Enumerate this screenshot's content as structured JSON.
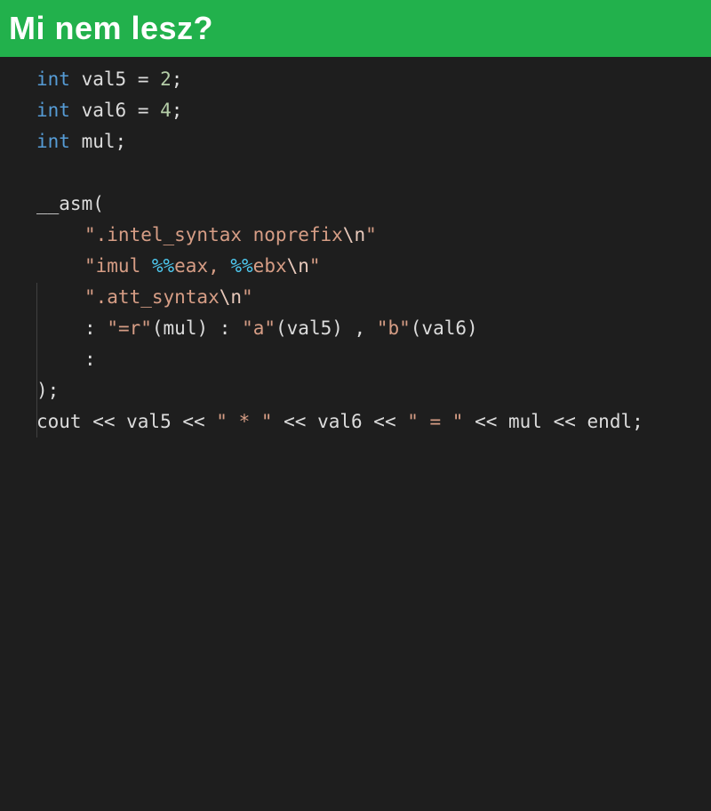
{
  "slide": {
    "title": "Mi nem lesz?"
  },
  "code": {
    "l1": {
      "type": "int",
      "name": "val5",
      "op": "=",
      "value": "2",
      "end": ";"
    },
    "l2": {
      "type": "int",
      "name": "val6",
      "op": "=",
      "value": "4",
      "end": ";"
    },
    "l3": {
      "type": "int",
      "name": "mul",
      "end": ";"
    },
    "l5": {
      "fn": "__asm",
      "paren": "("
    },
    "l6": {
      "q1": "\".intel_syntax noprefix",
      "esc": "\\n",
      "q2": "\""
    },
    "l7": {
      "q1": "\"imul ",
      "p1": "%%",
      "r1": "eax, ",
      "p2": "%%",
      "r2": "ebx",
      "esc": "\\n",
      "q2": "\""
    },
    "l8": {
      "q1": "\".att_syntax",
      "esc": "\\n",
      "q2": "\""
    },
    "l9": {
      "colon": ":",
      "c1": "\"=r\"",
      "a1": "(mul)",
      "colon2": ":",
      "c2": "\"a\"",
      "a2": "(val5)",
      "comma": ",",
      "c3": "\"b\"",
      "a3": "(val6)"
    },
    "l10": {
      "colon": ":"
    },
    "l11": {
      "close": ");"
    },
    "l12": {
      "t1": "cout << val5 << ",
      "s1": "\" * \"",
      "t2": " << val6 << ",
      "s2": "\" = \"",
      "t3": " << mul << endl;"
    }
  }
}
